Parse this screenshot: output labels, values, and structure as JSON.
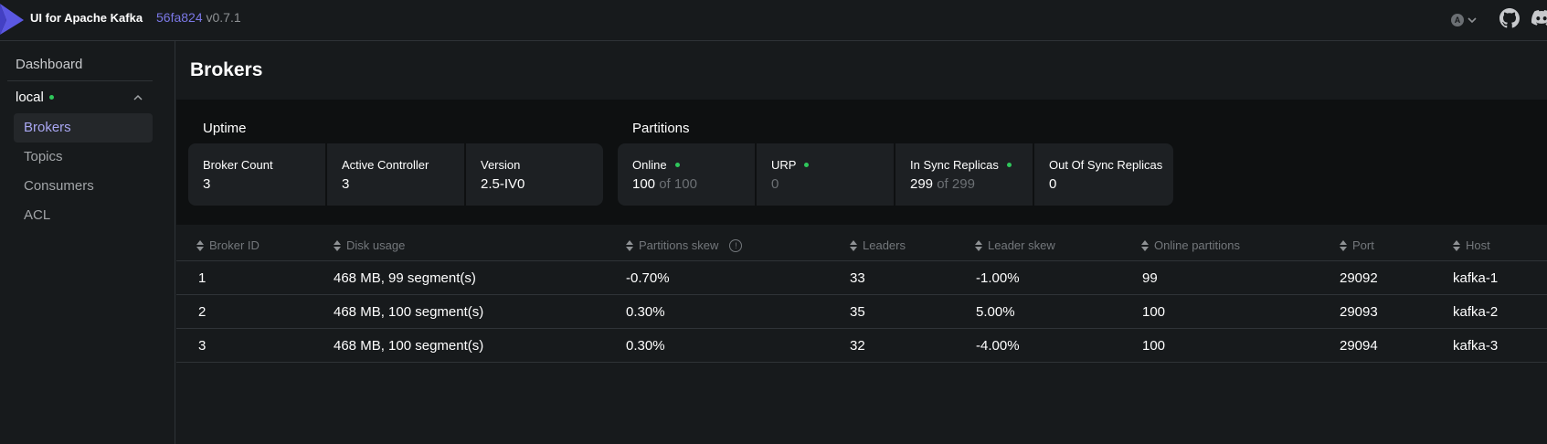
{
  "header": {
    "app_title": "UI for Apache Kafka",
    "commit": "56fa824",
    "version": "v0.7.1",
    "theme_letter": "A"
  },
  "sidebar": {
    "dashboard": "Dashboard",
    "cluster_name": "local",
    "items": [
      {
        "label": "Brokers",
        "active": true
      },
      {
        "label": "Topics",
        "active": false
      },
      {
        "label": "Consumers",
        "active": false
      },
      {
        "label": "ACL",
        "active": false
      }
    ]
  },
  "page": {
    "title": "Brokers"
  },
  "uptime": {
    "label": "Uptime",
    "cards": [
      {
        "title": "Broker Count",
        "value": "3"
      },
      {
        "title": "Active Controller",
        "value": "3"
      },
      {
        "title": "Version",
        "value": "2.5-IV0"
      }
    ]
  },
  "partitions": {
    "label": "Partitions",
    "cards": [
      {
        "title": "Online",
        "value": "100",
        "suffix": "of 100",
        "dot": true
      },
      {
        "title": "URP",
        "value": "0",
        "muted": true,
        "dot": true
      },
      {
        "title": "In Sync Replicas",
        "value": "299",
        "suffix": "of 299",
        "dot": true
      },
      {
        "title": "Out Of Sync Replicas",
        "value": "0"
      }
    ]
  },
  "table": {
    "columns": [
      "Broker ID",
      "Disk usage",
      "Partitions skew",
      "Leaders",
      "Leader skew",
      "Online partitions",
      "Port",
      "Host"
    ],
    "rows": [
      [
        "1",
        "468 MB, 99 segment(s)",
        "-0.70%",
        "33",
        "-1.00%",
        "99",
        "29092",
        "kafka-1"
      ],
      [
        "2",
        "468 MB, 100 segment(s)",
        "0.30%",
        "35",
        "5.00%",
        "100",
        "29093",
        "kafka-2"
      ],
      [
        "3",
        "468 MB, 100 segment(s)",
        "0.30%",
        "32",
        "-4.00%",
        "100",
        "29094",
        "kafka-3"
      ]
    ]
  },
  "colors": {
    "accent": "#7b78e6",
    "online_dot": "#2fc75b",
    "background": "#171a1c"
  }
}
